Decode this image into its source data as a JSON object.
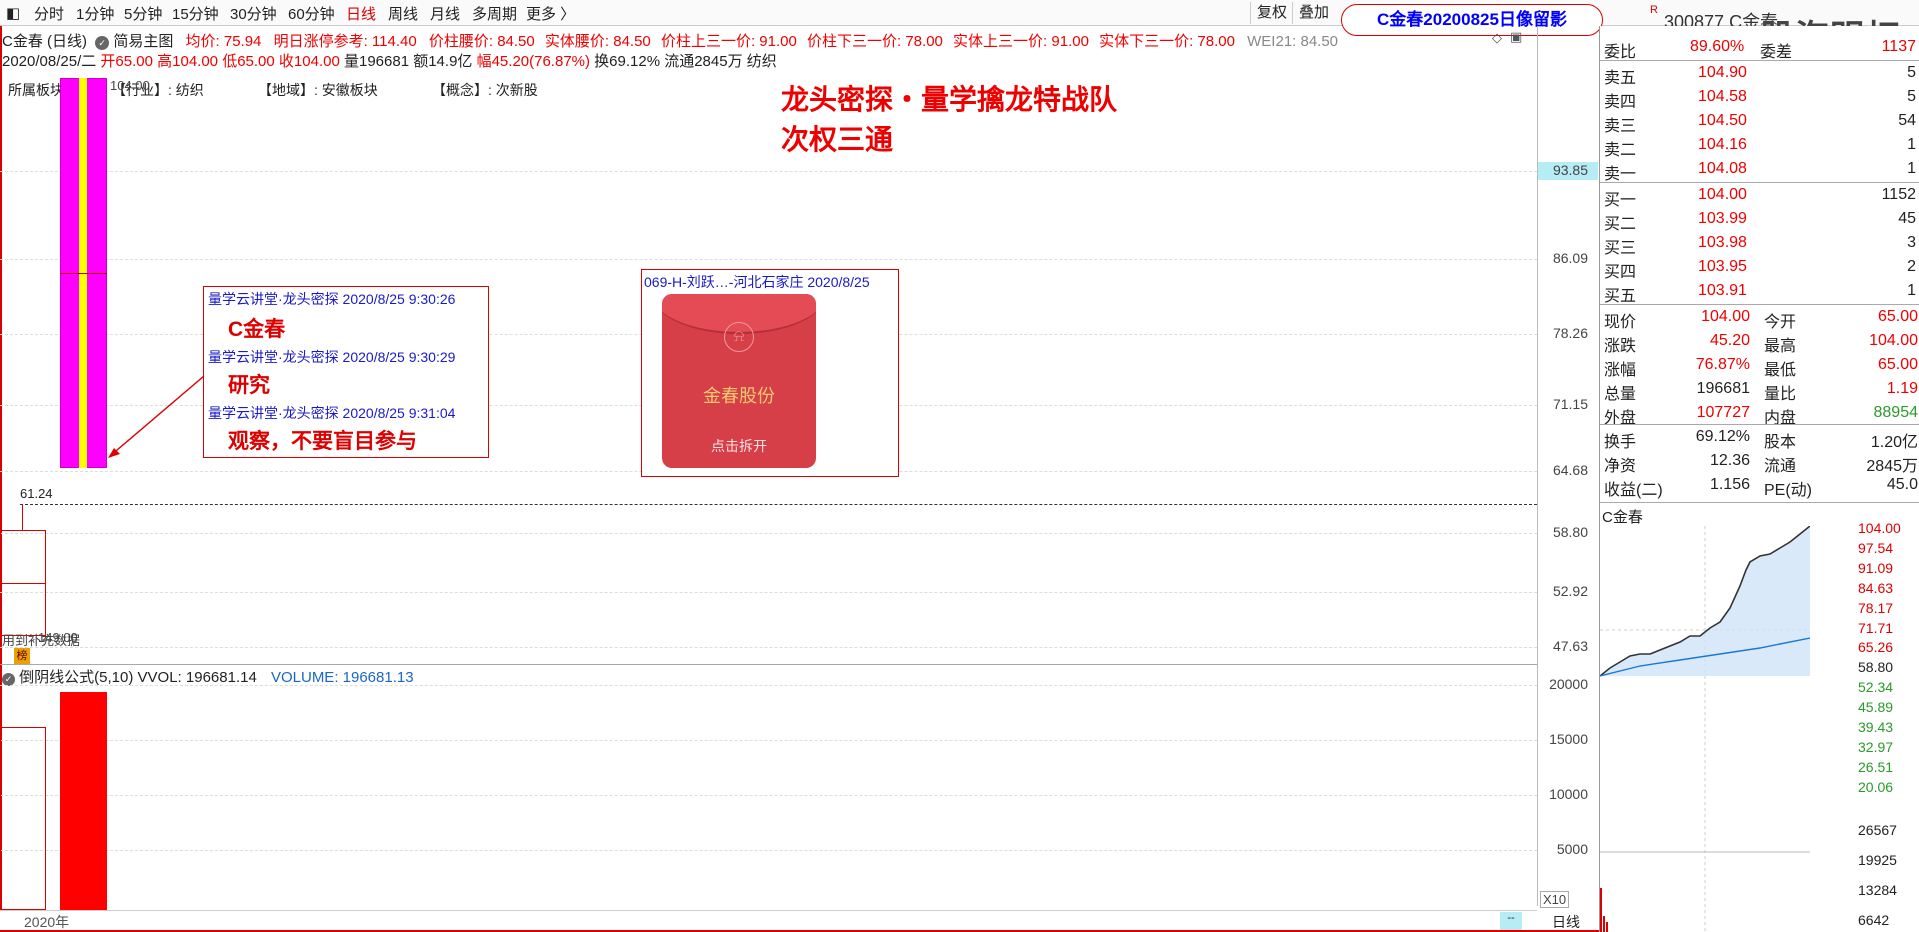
{
  "toolbar": {
    "items": [
      "分时",
      "1分钟",
      "5分钟",
      "15分钟",
      "30分钟",
      "60分钟",
      "日线",
      "周线",
      "月线",
      "多周期",
      "更多 〉"
    ],
    "fuquan": "复权",
    "diejia": "叠加",
    "title_badge": "C金春20200825日像留影"
  },
  "stock_header": {
    "code": "300877",
    "name": "C金春",
    "watermark": "股海明灯"
  },
  "chart_header": {
    "name": "C金春 (日线)",
    "mode": "简易主图",
    "avg": "均价: 75.94",
    "ref": "明日涨停参考: 114.40",
    "waist": "价柱腰价: 84.50",
    "body_waist": "实体腰价: 84.50",
    "upper": "价柱上三一价: 91.00",
    "lower": "价柱下三一价: 78.00",
    "body_upper": "实体上三一价: 91.00",
    "body_lower": "实体下三一价: 78.00",
    "wei": "WEI21: 84.50"
  },
  "date_line": {
    "date": "2020/08/25/二",
    "open": "开65.00",
    "high": "高104.00",
    "low": "低65.00",
    "close": "收104.00",
    "vol": "量196681",
    "amt": "额14.9亿",
    "amp": "幅45.20(76.87%)",
    "turnover": "换69.12%",
    "float": "流通2845万",
    "sector": "纺织"
  },
  "tags": {
    "industry_label": "所属板块",
    "industry_overlay": "【行业】: 纺织",
    "price_overlay": "104.00",
    "region": "【地域】: 安徽板块",
    "concept": "【概念】: 次新股"
  },
  "headline": {
    "line1": "龙头密探・量学擒龙特战队",
    "line2": "次权三通"
  },
  "notes": {
    "n1": "量学云讲堂·龙头密探 2020/8/25 9:30:26",
    "b1": "C金春",
    "n2": "量学云讲堂·龙头密探 2020/8/25 9:30:29",
    "b2": "研究",
    "n3": "量学云讲堂·龙头密探 2020/8/25 9:31:04",
    "b3": "观察，不要盲目参与"
  },
  "redpacket": {
    "header": "069-H-刘跃…-河北石家庄 2020/8/25",
    "company": "金春股份",
    "action": "点击拆开"
  },
  "price_axis": [
    "93.85",
    "86.09",
    "78.26",
    "71.15",
    "64.68",
    "58.80",
    "52.92",
    "47.63"
  ],
  "dashed_level": "61.24",
  "misc": {
    "small_label": "用到补充数据",
    "small_num": "149.00",
    "badge": "榜"
  },
  "volume": {
    "title": "倒阴线公式(5,10)",
    "vvol": "VVOL: 196681.14",
    "volume": "VOLUME: 196681.13",
    "axis": [
      "20000",
      "15000",
      "10000",
      "5000"
    ],
    "unit": "X10"
  },
  "bottom": {
    "year": "2020年",
    "period": "日线"
  },
  "orderbook": {
    "weibi_label": "委比",
    "weibi": "89.60%",
    "weicha_label": "委差",
    "weicha": "1137",
    "sells": [
      [
        "卖五",
        "104.90",
        "5"
      ],
      [
        "卖四",
        "104.58",
        "5"
      ],
      [
        "卖三",
        "104.50",
        "54"
      ],
      [
        "卖二",
        "104.16",
        "1"
      ],
      [
        "卖一",
        "104.08",
        "1"
      ]
    ],
    "buys": [
      [
        "买一",
        "104.00",
        "1152"
      ],
      [
        "买二",
        "103.99",
        "45"
      ],
      [
        "买三",
        "103.98",
        "3"
      ],
      [
        "买四",
        "103.95",
        "2"
      ],
      [
        "买五",
        "103.91",
        "1"
      ]
    ]
  },
  "quote": [
    [
      "现价",
      "104.00",
      "今开",
      "65.00"
    ],
    [
      "涨跌",
      "45.20",
      "最高",
      "104.00"
    ],
    [
      "涨幅",
      "76.87%",
      "最低",
      "65.00"
    ],
    [
      "总量",
      "196681",
      "量比",
      "1.19"
    ],
    [
      "外盘",
      "107727",
      "内盘",
      "88954"
    ]
  ],
  "fund": [
    [
      "换手",
      "69.12%",
      "股本",
      "1.20亿"
    ],
    [
      "净资",
      "12.36",
      "流通",
      "2845万"
    ],
    [
      "收益(二)",
      "1.156",
      "PE(动)",
      "45.0"
    ]
  ],
  "mini": {
    "name": "C金春",
    "price_axis": [
      "104.00",
      "97.54",
      "91.09",
      "84.63",
      "78.17",
      "71.71",
      "65.26",
      "58.80",
      "52.34",
      "45.89",
      "39.43",
      "32.97",
      "26.51",
      "20.06"
    ],
    "vol_axis": [
      "26567",
      "19925",
      "13284",
      "6642"
    ]
  }
}
